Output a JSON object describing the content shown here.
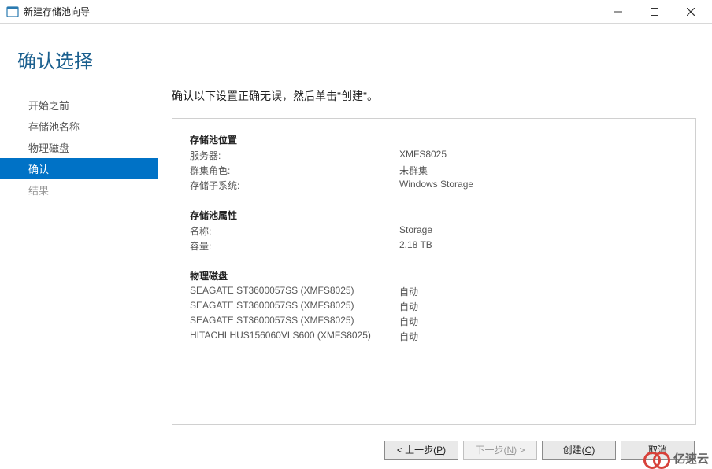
{
  "window": {
    "title": "新建存储池向导"
  },
  "page": {
    "title": "确认选择",
    "instruction": "确认以下设置正确无误，然后单击\"创建\"。"
  },
  "sidebar": {
    "items": [
      {
        "label": "开始之前",
        "state": "normal"
      },
      {
        "label": "存储池名称",
        "state": "normal"
      },
      {
        "label": "物理磁盘",
        "state": "normal"
      },
      {
        "label": "确认",
        "state": "active"
      },
      {
        "label": "结果",
        "state": "disabled"
      }
    ]
  },
  "sections": {
    "location": {
      "title": "存储池位置",
      "rows": [
        {
          "k": "服务器:",
          "v": "XMFS8025"
        },
        {
          "k": "群集角色:",
          "v": "未群集"
        },
        {
          "k": "存储子系统:",
          "v": "Windows Storage"
        }
      ]
    },
    "properties": {
      "title": "存储池属性",
      "rows": [
        {
          "k": "名称:",
          "v": "Storage"
        },
        {
          "k": "容量:",
          "v": "2.18 TB"
        }
      ]
    },
    "disks": {
      "title": "物理磁盘",
      "rows": [
        {
          "k": "SEAGATE ST3600057SS (XMFS8025)",
          "v": "自动"
        },
        {
          "k": "SEAGATE ST3600057SS (XMFS8025)",
          "v": "自动"
        },
        {
          "k": "SEAGATE ST3600057SS (XMFS8025)",
          "v": "自动"
        },
        {
          "k": "HITACHI HUS156060VLS600 (XMFS8025)",
          "v": "自动"
        }
      ]
    }
  },
  "footer": {
    "prev_prefix": "< 上一步(",
    "prev_key": "P",
    "prev_suffix": ")",
    "next_prefix": "下一步(",
    "next_key": "N",
    "next_suffix": ") >",
    "create_prefix": "创建(",
    "create_key": "C",
    "create_suffix": ")",
    "cancel": "取消"
  },
  "watermark": "亿速云"
}
